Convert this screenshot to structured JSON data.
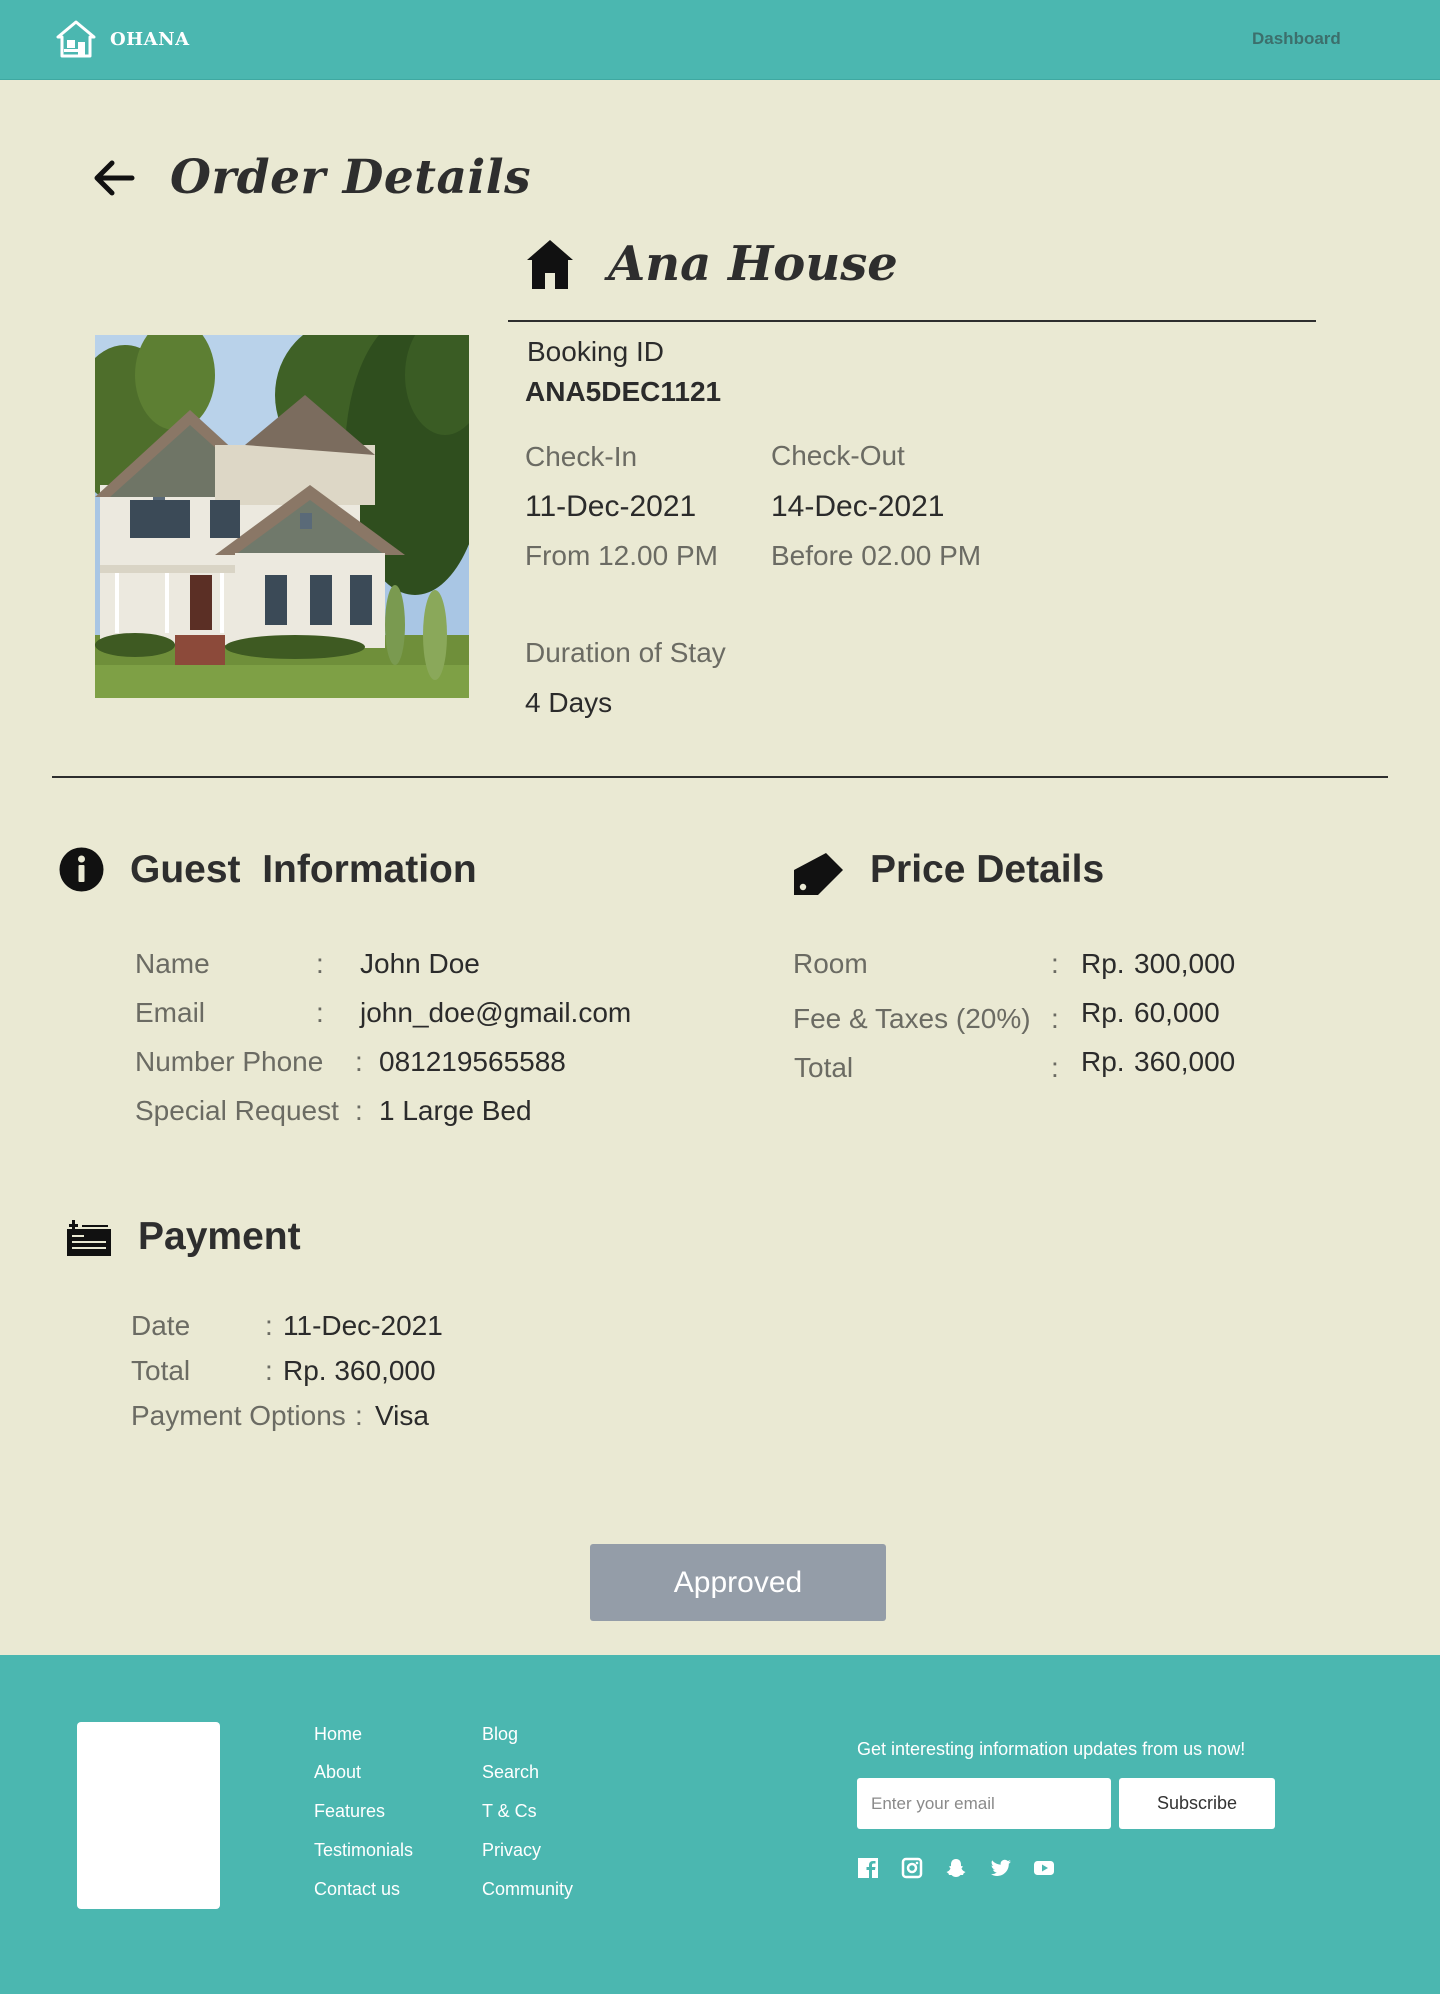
{
  "navbar": {
    "brand": "OHANA",
    "dashboard_link": "Dashboard"
  },
  "page": {
    "title": "Order Details"
  },
  "property": {
    "name": "Ana House",
    "photo": "house-photo"
  },
  "booking": {
    "id_label": "Booking ID",
    "id_value": "ANA5DEC1121",
    "checkin_label": "Check-In",
    "checkin_date": "11-Dec-2021",
    "checkin_time": "From 12.00 PM",
    "checkout_label": "Check-Out",
    "checkout_date": "14-Dec-2021",
    "checkout_time": "Before 02.00 PM",
    "duration_label": "Duration of Stay",
    "duration_value": "4 Days"
  },
  "guest": {
    "heading": "Guest  Information",
    "rows": [
      {
        "label": "Name",
        "value": "John Doe"
      },
      {
        "label": "Email",
        "value": "john_doe@gmail.com"
      },
      {
        "label": "Number Phone",
        "value": "081219565588"
      },
      {
        "label": "Special Request",
        "value": "1 Large Bed"
      }
    ]
  },
  "price": {
    "heading": "Price Details",
    "currency": "Rp.",
    "rows": [
      {
        "label": "Room",
        "value": "300,000"
      },
      {
        "label": "Fee & Taxes (20%)",
        "value": "60,000"
      },
      {
        "label": "Total",
        "value": "360,000"
      }
    ]
  },
  "payment": {
    "heading": "Payment",
    "rows": [
      {
        "label": "Date",
        "value": "11-Dec-2021"
      },
      {
        "label": "Total",
        "value": "Rp. 360,000"
      },
      {
        "label": "Payment Options",
        "value": "Visa"
      }
    ]
  },
  "separator": ":",
  "actions": {
    "approve_label": "Approved"
  },
  "footer": {
    "links_col1": [
      "Home",
      "About",
      "Features",
      "Testimonials",
      "Contact us"
    ],
    "links_col2": [
      "Blog",
      "Search",
      "T & Cs",
      "Privacy",
      "Community"
    ],
    "newsletter_text": "Get interesting information updates from us now!",
    "email_placeholder": "Enter your email",
    "subscribe_label": "Subscribe",
    "social_icons": [
      "facebook-icon",
      "instagram-icon",
      "snapchat-icon",
      "twitter-icon",
      "youtube-icon"
    ]
  },
  "colors": {
    "teal": "#4BB7B0",
    "background": "#EAE9D3",
    "button_gray": "#949DA8",
    "text_dark": "#2b2b2b",
    "text_muted": "#6b6b63"
  }
}
